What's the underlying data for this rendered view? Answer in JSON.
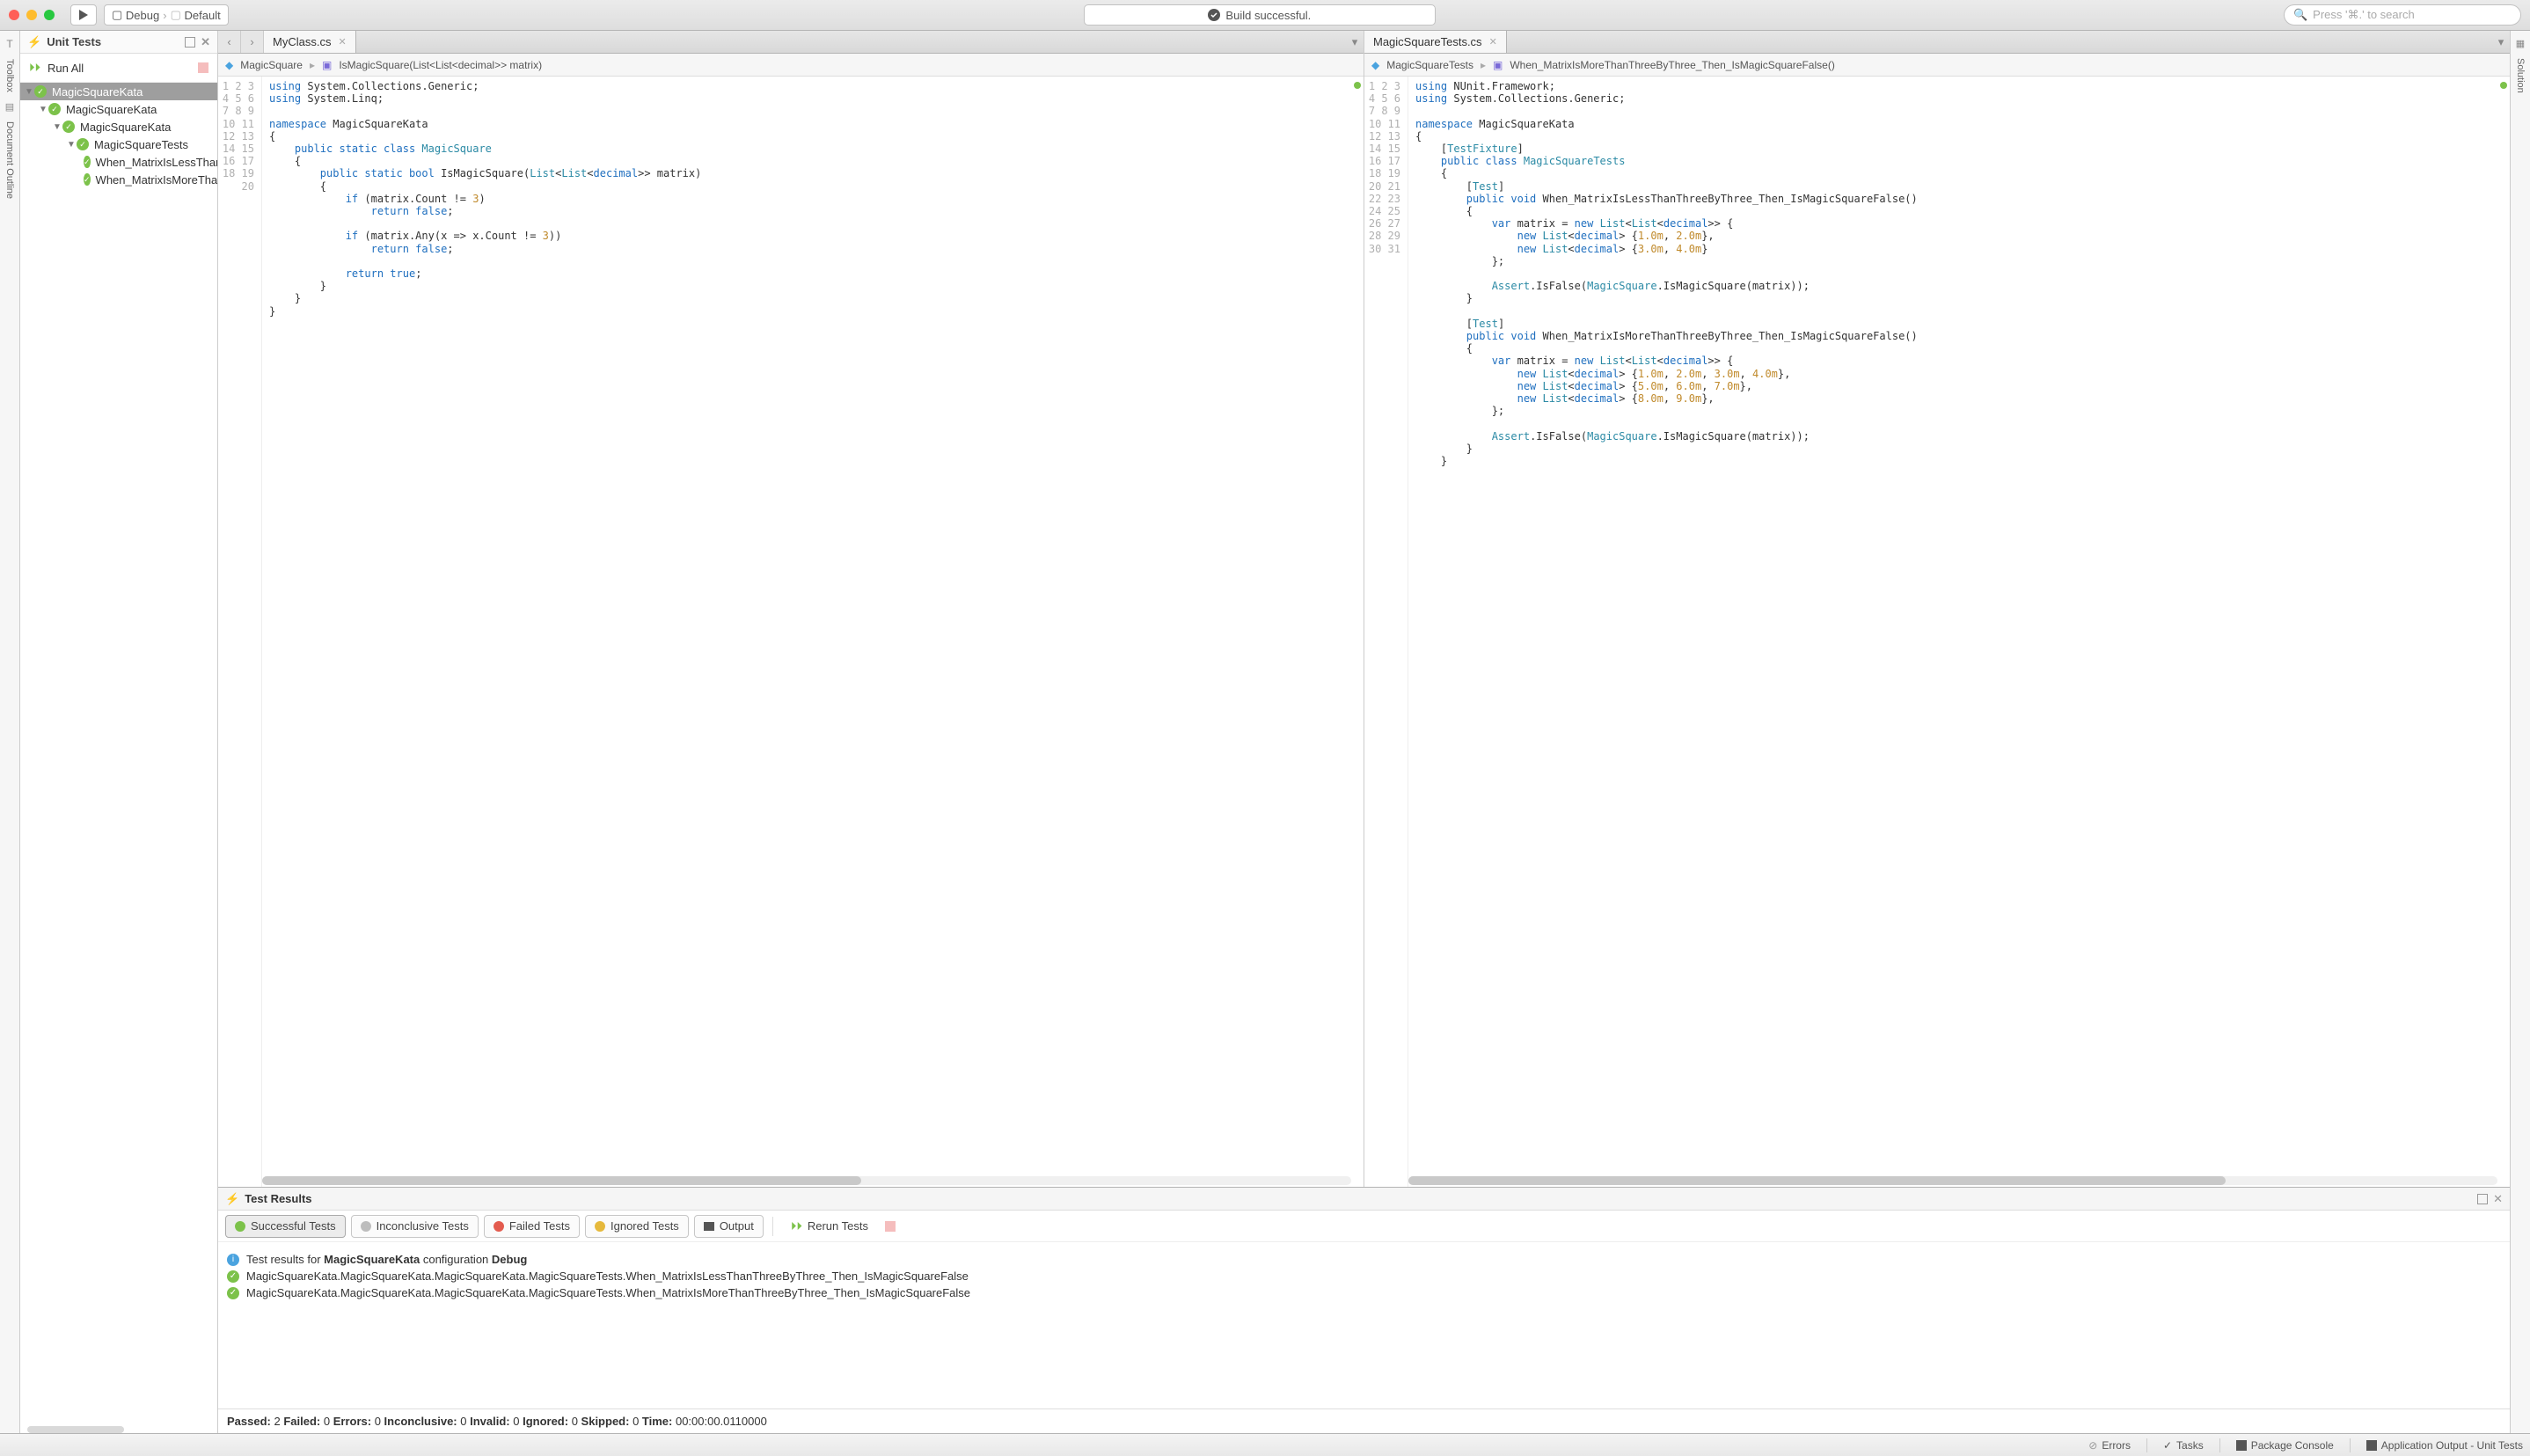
{
  "toolbar": {
    "config": "Debug",
    "target": "Default",
    "build_status": "Build successful.",
    "search_placeholder": "Press '⌘.' to search"
  },
  "left_rail": {
    "toolbox": "Toolbox",
    "outline": "Document Outline"
  },
  "right_rail": {
    "solution": "Solution"
  },
  "unit_tests": {
    "title": "Unit Tests",
    "run_all": "Run All",
    "tree": {
      "root": "MagicSquareKata",
      "l1": "MagicSquareKata",
      "l2": "MagicSquareKata",
      "l3": "MagicSquareTests",
      "t1": "When_MatrixIsLessThanThreeByThree_Then_IsMagicSquareFalse",
      "t2": "When_MatrixIsMoreThanThreeByThree_Then_IsMagicSquareFalse"
    }
  },
  "editor_left": {
    "tab": "MyClass.cs",
    "crumb1": "MagicSquare",
    "crumb2": "IsMagicSquare(List<List<decimal>> matrix)"
  },
  "editor_right": {
    "tab": "MagicSquareTests.cs",
    "crumb1": "MagicSquareTests",
    "crumb2": "When_MatrixIsMoreThanThreeByThree_Then_IsMagicSquareFalse()"
  },
  "test_results": {
    "title": "Test Results",
    "filters": {
      "success": "Successful Tests",
      "inconclusive": "Inconclusive Tests",
      "failed": "Failed Tests",
      "ignored": "Ignored Tests",
      "output": "Output",
      "rerun": "Rerun Tests"
    },
    "info_prefix": "Test results for ",
    "info_project": "MagicSquareKata",
    "info_mid": " configuration ",
    "info_config": "Debug",
    "line1": "MagicSquareKata.MagicSquareKata.MagicSquareKata.MagicSquareTests.When_MatrixIsLessThanThreeByThree_Then_IsMagicSquareFalse",
    "line2": "MagicSquareKata.MagicSquareKata.MagicSquareKata.MagicSquareTests.When_MatrixIsMoreThanThreeByThree_Then_IsMagicSquareFalse",
    "summary": {
      "passed_l": "Passed:",
      "passed_v": " 2   ",
      "failed_l": "Failed:",
      "failed_v": " 0   ",
      "errors_l": "Errors:",
      "errors_v": " 0   ",
      "inc_l": "Inconclusive:",
      "inc_v": " 0   ",
      "inv_l": "Invalid:",
      "inv_v": " 0   ",
      "ign_l": "Ignored:",
      "ign_v": " 0   ",
      "skip_l": "Skipped:",
      "skip_v": " 0   ",
      "time_l": "Time:",
      "time_v": " 00:00:00.0110000"
    }
  },
  "statusbar": {
    "errors": "Errors",
    "tasks": "Tasks",
    "package": "Package Console",
    "output": "Application Output - Unit Tests"
  }
}
